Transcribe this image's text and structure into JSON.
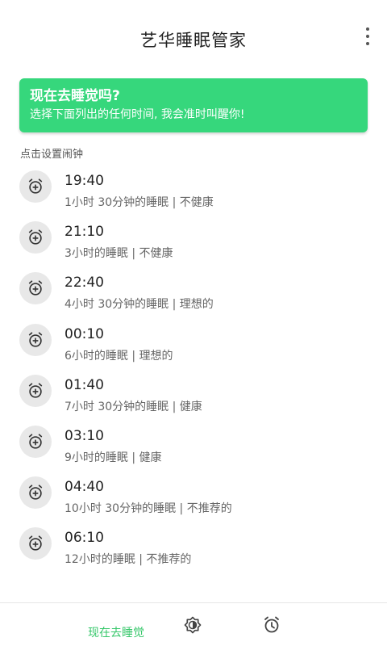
{
  "app": {
    "title": "艺华睡眠管家"
  },
  "banner": {
    "title": "现在去睡觉吗?",
    "subtitle": "选择下面列出的任何时间, 我会准时叫醒你!"
  },
  "section_label": "点击设置闹钟",
  "alarms": [
    {
      "time": "19:40",
      "desc": "1小时 30分钟的睡眠 | 不健康"
    },
    {
      "time": "21:10",
      "desc": "3小时的睡眠 | 不健康"
    },
    {
      "time": "22:40",
      "desc": "4小时 30分钟的睡眠 | 理想的"
    },
    {
      "time": "00:10",
      "desc": "6小时的睡眠 | 理想的"
    },
    {
      "time": "01:40",
      "desc": "7小时 30分钟的睡眠 | 健康"
    },
    {
      "time": "03:10",
      "desc": "9小时的睡眠 | 健康"
    },
    {
      "time": "04:40",
      "desc": "10小时 30分钟的睡眠 | 不推荐的"
    },
    {
      "time": "06:10",
      "desc": "12小时的睡眠 | 不推荐的"
    }
  ],
  "bottom_nav": {
    "now_label": "现在去睡觉",
    "icons": [
      "brightness-icon",
      "alarm-clock-icon"
    ]
  },
  "colors": {
    "accent": "#36d77c",
    "icon_bg": "#e8e8e8"
  }
}
